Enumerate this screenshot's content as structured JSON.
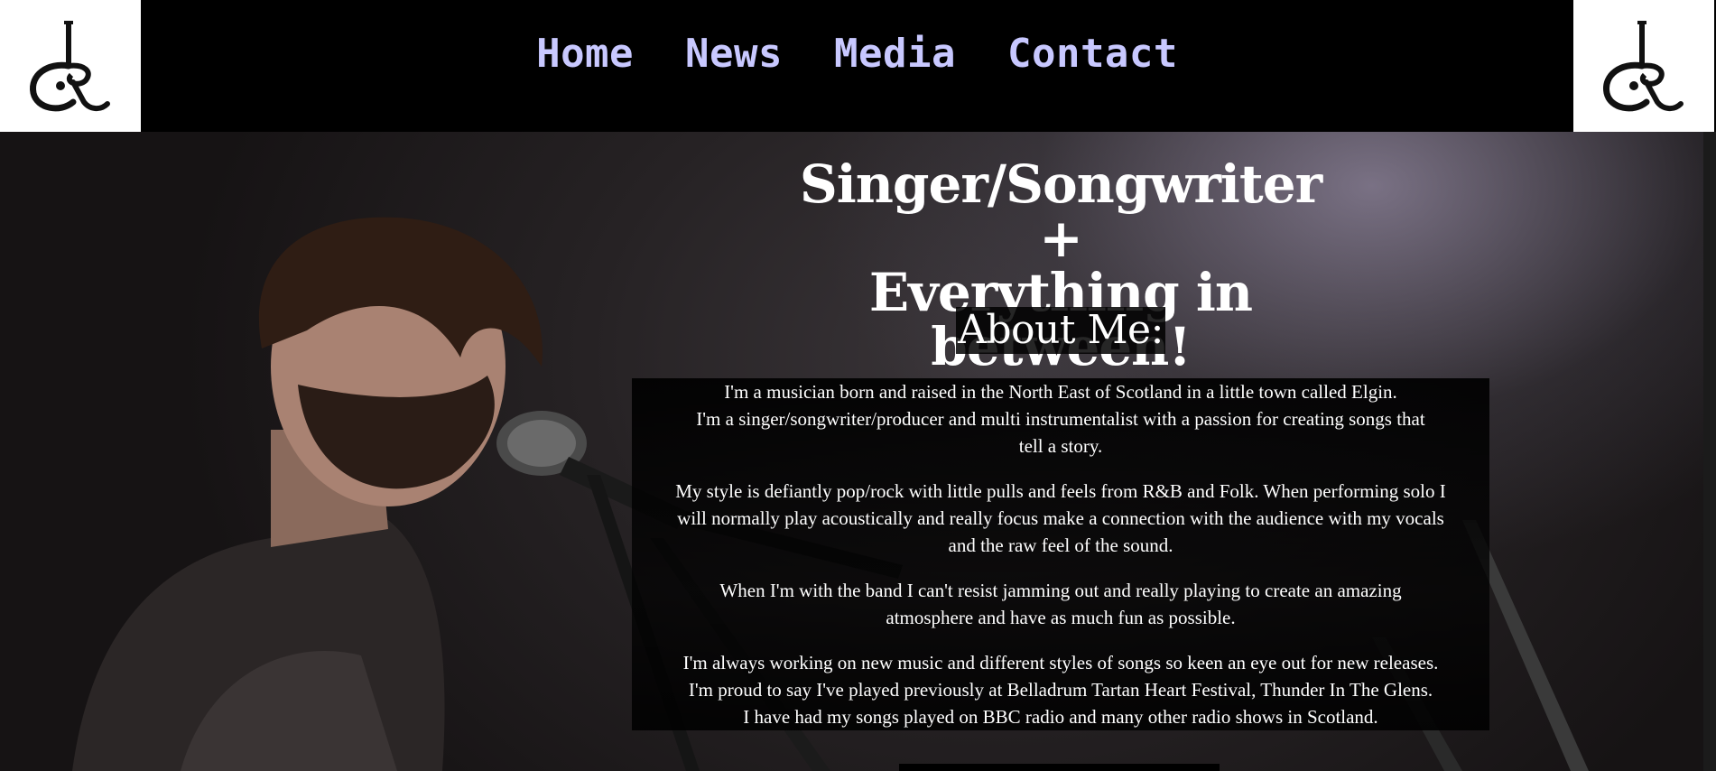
{
  "nav": {
    "items": [
      {
        "label": "Home"
      },
      {
        "label": "News"
      },
      {
        "label": "Media"
      },
      {
        "label": "Contact"
      }
    ]
  },
  "logo": {
    "monogram": "SR"
  },
  "hero": {
    "title_line1": "Singer/Songwriter +",
    "title_line2": "Everything in between!",
    "about_title": "About Me:",
    "paragraphs": [
      [
        "I'm a musician born and raised in the North East of Scotland in a little town called Elgin.",
        "I'm a singer/songwriter/producer and multi instrumentalist with a passion for creating songs that",
        "tell a story."
      ],
      [
        "My style is defiantly pop/rock with little pulls and feels from R&B and Folk. When performing solo I",
        "will normally play acoustically and really focus make a connection with the audience with my vocals",
        "and the raw feel of the sound."
      ],
      [
        "When I'm with the band I can't resist jamming out and really playing to create an amazing",
        "atmosphere and have as much fun as possible."
      ],
      [
        "I'm always working on new music and different styles of songs so keen an eye out for new releases.",
        "I'm proud to say I've played previously at Belladrum Tartan Heart Festival, Thunder In The Glens.",
        "I have had my songs played on BBC radio and many other radio shows in Scotland."
      ]
    ]
  },
  "colors": {
    "nav_link": "#c8c8ff",
    "header_bg": "#000000",
    "logo_bg": "#ffffff"
  }
}
